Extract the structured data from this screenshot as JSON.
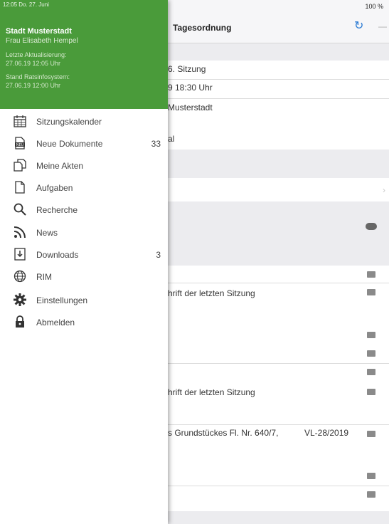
{
  "background": {
    "status_right": "100 %",
    "nav_title": "Tagesordnung",
    "refresh_icon": "refresh-icon",
    "rows": {
      "meeting_title": "6. Sitzung",
      "meeting_time": "9 18:30 Uhr",
      "meeting_place": "Musterstadt",
      "meeting_extra": "al",
      "item_2": "hrift der letzten Sitzung",
      "item_5": "hrift der letzten Sitzung",
      "item_6": "s Grundstückes Fl. Nr. 640/7,",
      "item_6_ref": "VL-28/2019"
    }
  },
  "drawer": {
    "status": "12:05  Do. 27. Juni",
    "org": "Stadt Musterstadt",
    "user": "Frau Elisabeth Hempel",
    "last_update_label": "Letzte Aktualisierung:",
    "last_update_value": "27.06.19 12:05 Uhr",
    "ris_label": "Stand Ratsinfosystem:",
    "ris_value": "27.06.19 12:00 Uhr",
    "accent_color": "#4a9b3a",
    "items": [
      {
        "label": "Sitzungskalender",
        "icon": "calendar-icon"
      },
      {
        "label": "Neue Dokumente",
        "icon": "new-document-icon",
        "count": "33"
      },
      {
        "label": "Meine Akten",
        "icon": "files-icon"
      },
      {
        "label": "Aufgaben",
        "icon": "document-icon"
      },
      {
        "label": "Recherche",
        "icon": "search-icon"
      },
      {
        "label": "News",
        "icon": "rss-icon"
      },
      {
        "label": "Downloads",
        "icon": "download-icon",
        "count": "3"
      },
      {
        "label": "RIM",
        "icon": "globe-icon"
      },
      {
        "label": "Einstellungen",
        "icon": "gear-icon"
      },
      {
        "label": "Abmelden",
        "icon": "lock-icon"
      }
    ]
  }
}
